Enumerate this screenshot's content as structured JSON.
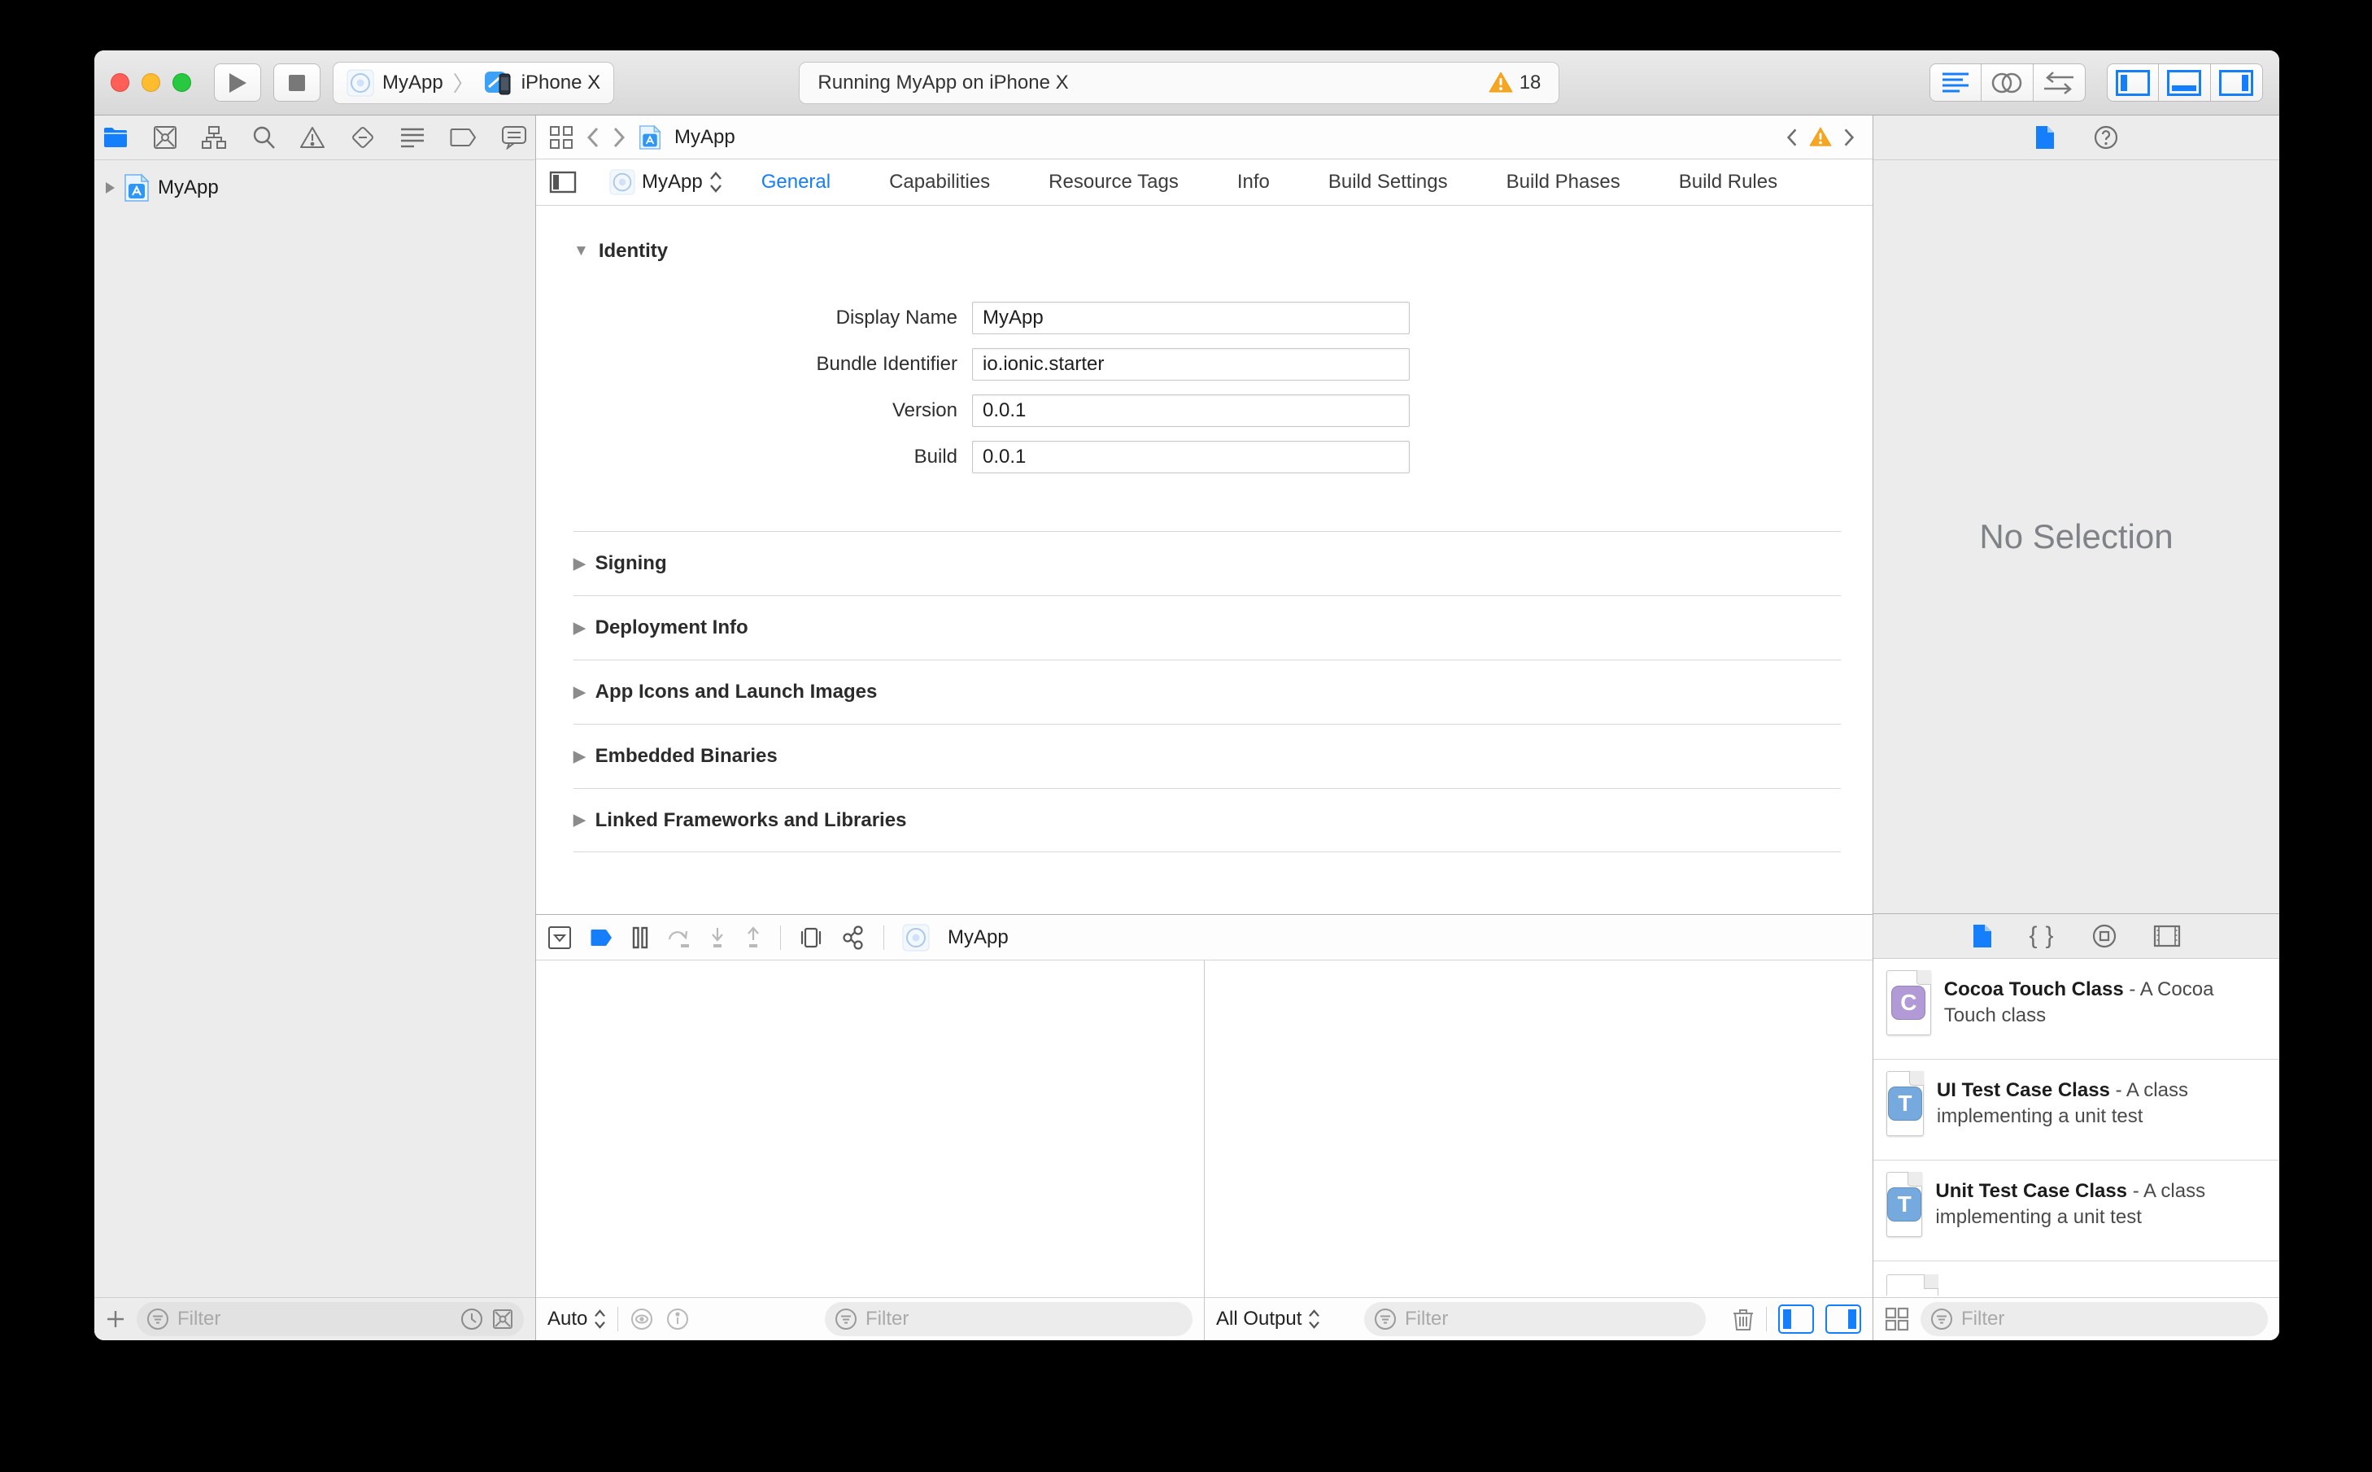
{
  "toolbar": {
    "scheme_target": "MyApp",
    "scheme_device": "iPhone X",
    "status_message": "Running MyApp on iPhone X",
    "warning_count": "18"
  },
  "navigator": {
    "project_name": "MyApp",
    "filter_placeholder": "Filter",
    "icon_names": [
      "project-navigator-icon",
      "source-control-icon",
      "symbol-navigator-icon",
      "find-navigator-icon",
      "issue-navigator-icon",
      "test-navigator-icon",
      "debug-navigator-icon",
      "breakpoint-navigator-icon",
      "report-navigator-icon"
    ]
  },
  "editor": {
    "jumpbar_file": "MyApp",
    "target_name": "MyApp",
    "tabs": [
      {
        "label": "General",
        "active": true
      },
      {
        "label": "Capabilities",
        "active": false
      },
      {
        "label": "Resource Tags",
        "active": false
      },
      {
        "label": "Info",
        "active": false
      },
      {
        "label": "Build Settings",
        "active": false
      },
      {
        "label": "Build Phases",
        "active": false
      },
      {
        "label": "Build Rules",
        "active": false
      }
    ],
    "identity_header": "Identity",
    "fields": [
      {
        "label": "Display Name",
        "value": "MyApp"
      },
      {
        "label": "Bundle Identifier",
        "value": "io.ionic.starter"
      },
      {
        "label": "Version",
        "value": "0.0.1"
      },
      {
        "label": "Build",
        "value": "0.0.1"
      }
    ],
    "sections": [
      {
        "title": "Signing"
      },
      {
        "title": "Deployment Info"
      },
      {
        "title": "App Icons and Launch Images"
      },
      {
        "title": "Embedded Binaries"
      },
      {
        "title": "Linked Frameworks and Libraries"
      }
    ]
  },
  "debug": {
    "target_name": "MyApp",
    "variables_scope": "Auto",
    "console_scope": "All Output",
    "variables_filter_placeholder": "Filter",
    "console_filter_placeholder": "Filter"
  },
  "inspector": {
    "empty_message": "No Selection"
  },
  "library": {
    "items": [
      {
        "letter": "C",
        "color": "#b29ad6",
        "title": "Cocoa Touch Class",
        "desc": " - A Cocoa Touch class"
      },
      {
        "letter": "T",
        "color": "#76aade",
        "title": "UI Test Case Class",
        "desc": " - A class implementing a unit test"
      },
      {
        "letter": "T",
        "color": "#76aade",
        "title": "Unit Test Case Class",
        "desc": " - A class implementing a unit test"
      }
    ],
    "filter_placeholder": "Filter"
  },
  "colors": {
    "accent": "#157efa",
    "warning": "#f5a623"
  }
}
